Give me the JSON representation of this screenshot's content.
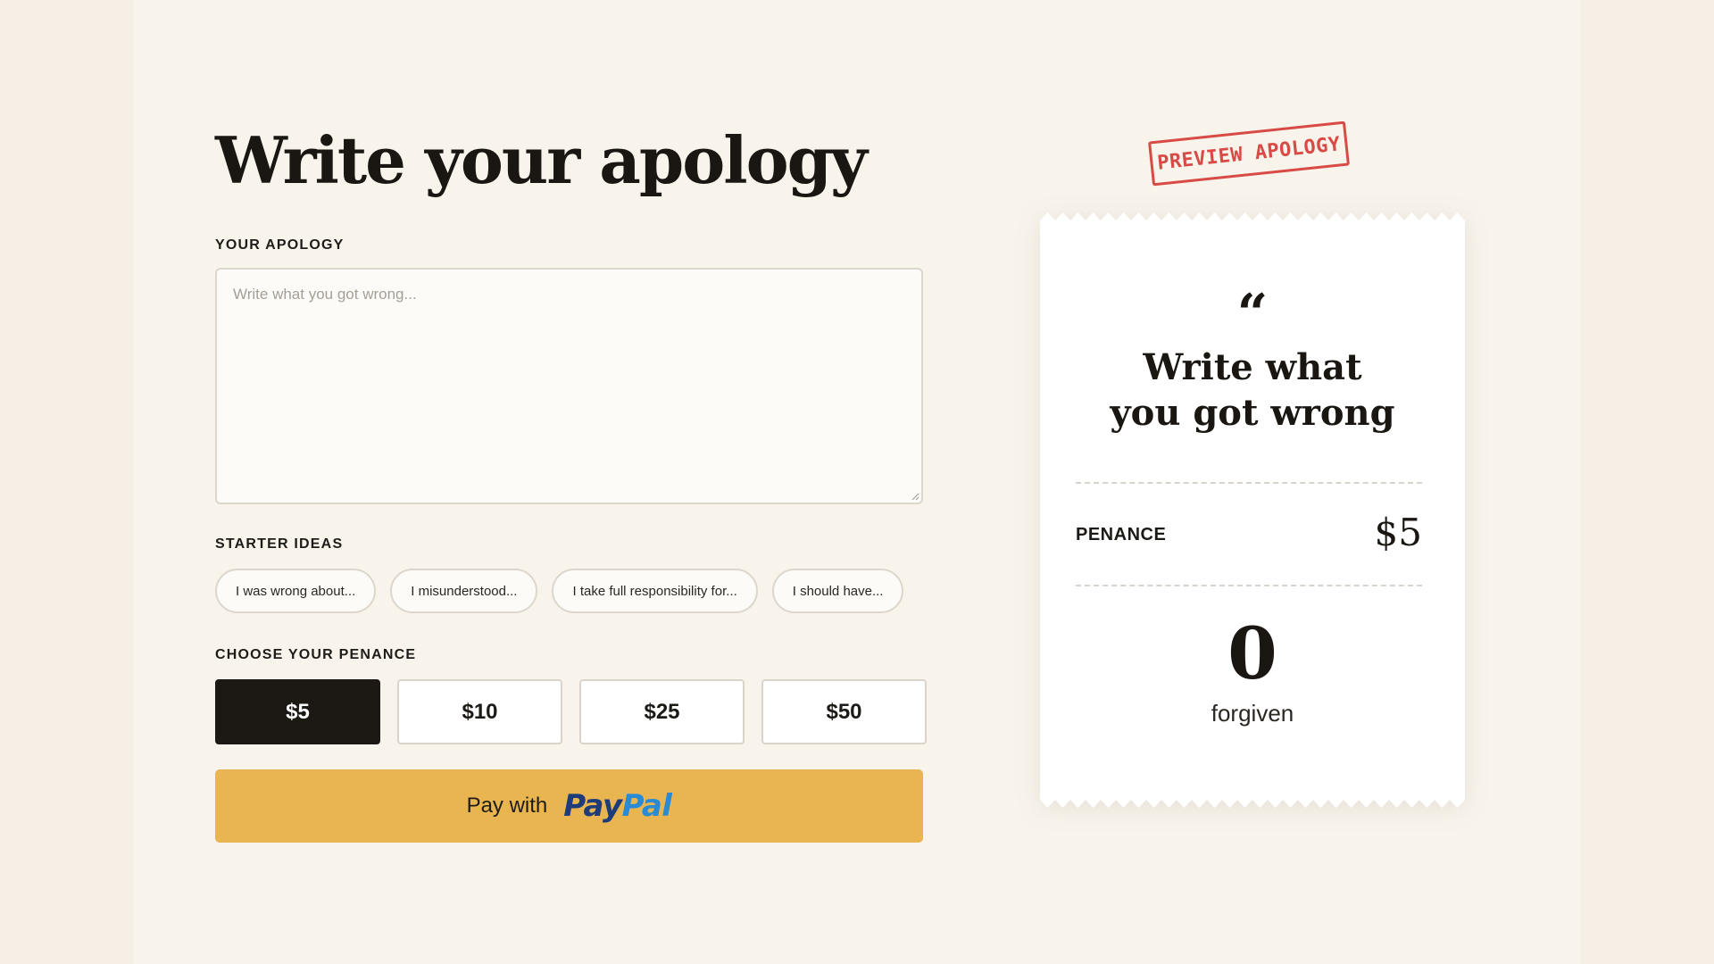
{
  "form": {
    "title": "Write your apology",
    "apology_label": "YOUR APOLOGY",
    "apology_placeholder": "Write what you got wrong...",
    "apology_value": "",
    "starter_label": "STARTER IDEAS",
    "starter_ideas": [
      "I was wrong about...",
      "I misunderstood...",
      "I take full responsibility for...",
      "I should have..."
    ],
    "penance_label": "CHOOSE YOUR PENANCE",
    "penance_options": [
      "$5",
      "$10",
      "$25",
      "$50"
    ],
    "selected_penance": "$5",
    "pay_button_text": "Pay with",
    "paypal_logo_part1": "Pay",
    "paypal_logo_part2": "Pal"
  },
  "preview": {
    "stamp_text": "PREVIEW APOLOGY",
    "quote_glyph": "“",
    "apology_text": "Write what you got wrong",
    "penance_label": "PENANCE",
    "penance_value": "$5",
    "forgiven_count": "0",
    "forgiven_label": "forgiven"
  },
  "colors": {
    "background": "#f5efe6",
    "selected_amount": "#1c1914",
    "paypal_button": "#e8b551",
    "paypal_dark_blue": "#1e3b7a",
    "paypal_light_blue": "#2a8ad3",
    "stamp_red": "#d84a45"
  }
}
